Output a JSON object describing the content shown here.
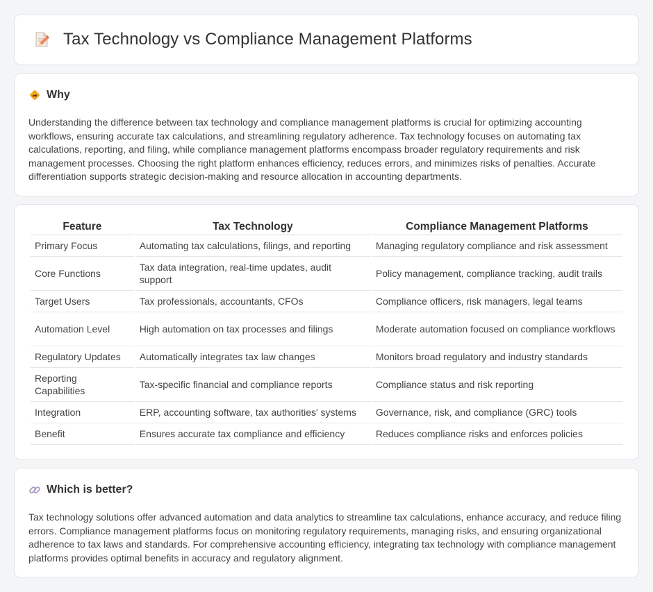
{
  "header": {
    "title": "Tax Technology vs Compliance Management Platforms",
    "icon": "document-pencil-icon"
  },
  "why": {
    "icon": "diamond-sign-icon",
    "title": "Why",
    "text": "Understanding the difference between tax technology and compliance management platforms is crucial for optimizing accounting workflows, ensuring accurate tax calculations, and streamlining regulatory adherence. Tax technology focuses on automating tax calculations, reporting, and filing, while compliance management platforms encompass broader regulatory requirements and risk management processes. Choosing the right platform enhances efficiency, reduces errors, and minimizes risks of penalties. Accurate differentiation supports strategic decision-making and resource allocation in accounting departments."
  },
  "table": {
    "headers": [
      "Feature",
      "Tax Technology",
      "Compliance Management Platforms"
    ],
    "rows": [
      [
        "Primary Focus",
        "Automating tax calculations, filings, and reporting",
        "Managing regulatory compliance and risk assessment"
      ],
      [
        "Core Functions",
        "Tax data integration, real-time updates, audit support",
        "Policy management, compliance tracking, audit trails"
      ],
      [
        "Target Users",
        "Tax professionals, accountants, CFOs",
        "Compliance officers, risk managers, legal teams"
      ],
      [
        "Automation Level",
        "High automation on tax processes and filings",
        "Moderate automation focused on compliance workflows"
      ],
      [
        "Regulatory Updates",
        "Automatically integrates tax law changes",
        "Monitors broad regulatory and industry standards"
      ],
      [
        "Reporting Capabilities",
        "Tax-specific financial and compliance reports",
        "Compliance status and risk reporting"
      ],
      [
        "Integration",
        "ERP, accounting software, tax authorities' systems",
        "Governance, risk, and compliance (GRC) tools"
      ],
      [
        "Benefit",
        "Ensures accurate tax compliance and efficiency",
        "Reduces compliance risks and enforces policies"
      ]
    ]
  },
  "which": {
    "icon": "link-icon",
    "title": "Which is better?",
    "text": "Tax technology solutions offer advanced automation and data analytics to streamline tax calculations, enhance accuracy, and reduce filing errors. Compliance management platforms focus on monitoring regulatory requirements, managing risks, and ensuring organizational adherence to tax laws and standards. For comprehensive accounting efficiency, integrating tax technology with compliance management platforms provides optimal benefits in accuracy and regulatory alignment."
  }
}
